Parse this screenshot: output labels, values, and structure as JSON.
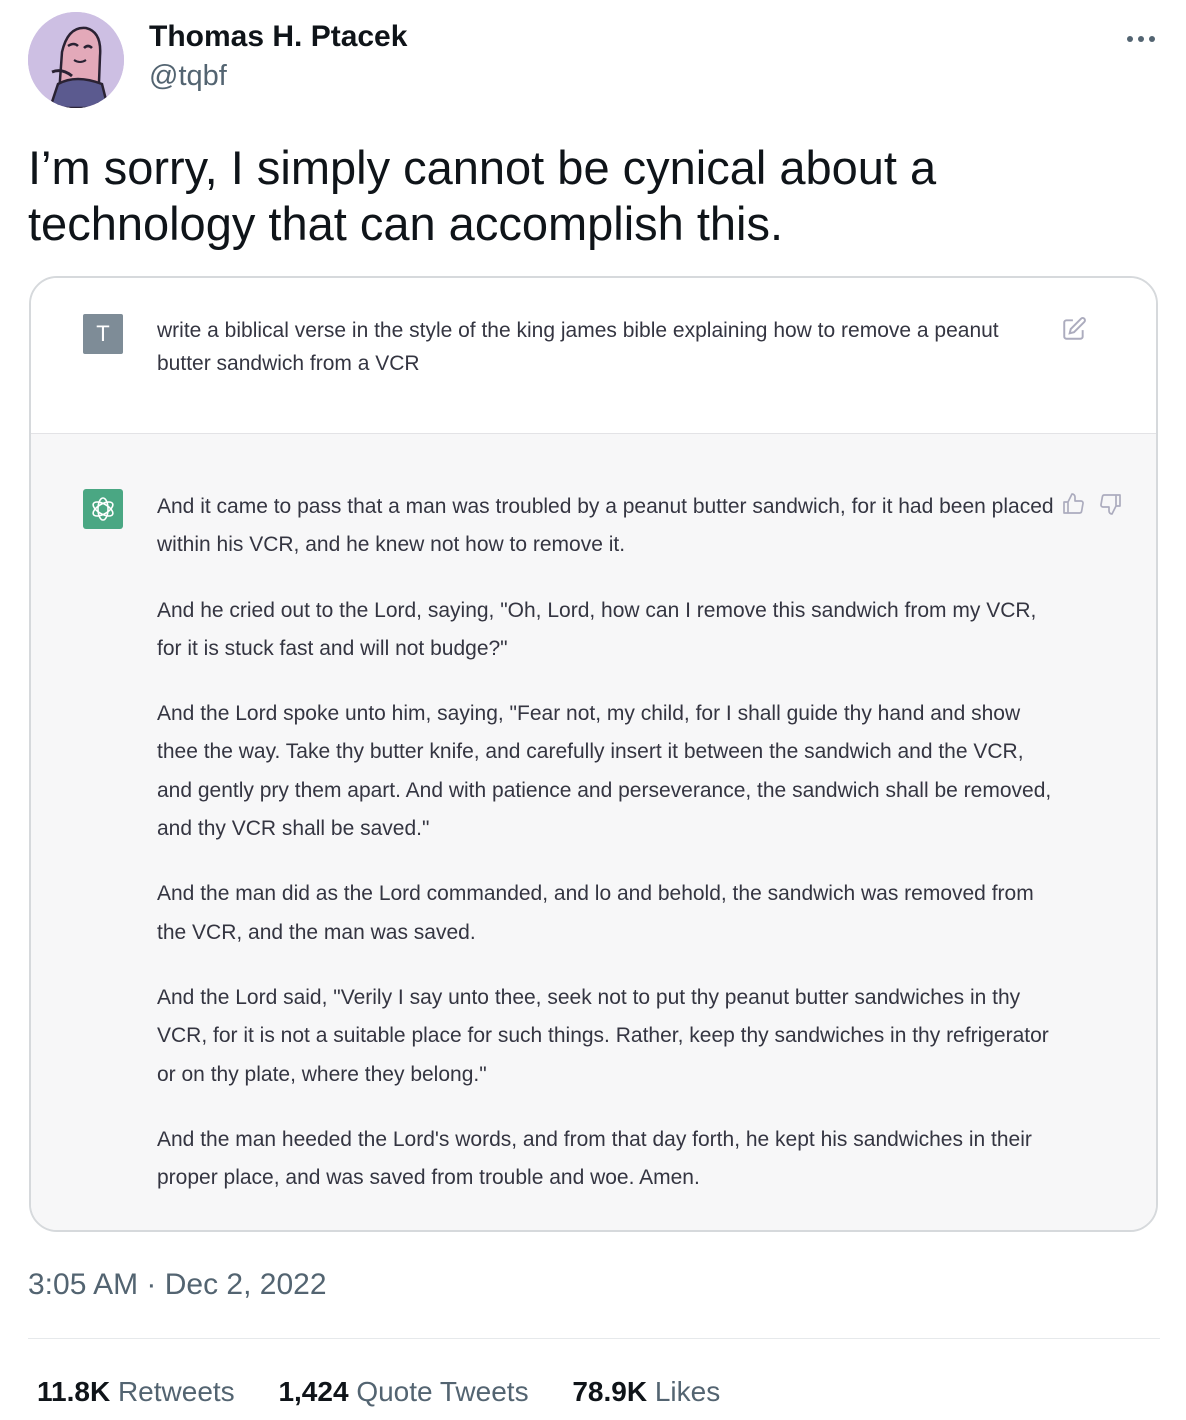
{
  "author": {
    "display_name": "Thomas H. Ptacek",
    "handle": "@tqbf",
    "avatar_icon": "avatar-illustration"
  },
  "tweet": {
    "text": "I’m sorry, I simply cannot be cynical about a technology that can accomplish this."
  },
  "screenshot_card": {
    "user_badge": "T",
    "prompt": "write a biblical verse in the style of the king james bible explaining how to remove a peanut butter sandwich from a VCR",
    "response_paragraphs": [
      "And it came to pass that a man was troubled by a peanut butter sandwich, for it had been placed within his VCR, and he knew not how to remove it.",
      "And he cried out to the Lord, saying, \"Oh, Lord, how can I remove this sandwich from my VCR, for it is stuck fast and will not budge?\"",
      "And the Lord spoke unto him, saying, \"Fear not, my child, for I shall guide thy hand and show thee the way. Take thy butter knife, and carefully insert it between the sandwich and the VCR, and gently pry them apart. And with patience and perseverance, the sandwich shall be removed, and thy VCR shall be saved.\"",
      "And the man did as the Lord commanded, and lo and behold, the sandwich was removed from the VCR, and the man was saved.",
      "And the Lord said, \"Verily I say unto thee, seek not to put thy peanut butter sandwiches in thy VCR, for it is not a suitable place for such things. Rather, keep thy sandwiches in thy refrigerator or on thy plate, where they belong.\"",
      "And the man heeded the Lord's words, and from that day forth, he kept his sandwiches in their proper place, and was saved from trouble and woe. Amen."
    ],
    "colors": {
      "assistant_badge": "#4aa783",
      "user_badge": "#7e8c97",
      "assistant_bg": "#f7f7f8"
    }
  },
  "timestamp": "3:05 AM · Dec 2, 2022",
  "stats": {
    "retweets_count": "11.8K",
    "retweets_label": "Retweets",
    "quotes_count": "1,424",
    "quotes_label": "Quote Tweets",
    "likes_count": "78.9K",
    "likes_label": "Likes"
  }
}
